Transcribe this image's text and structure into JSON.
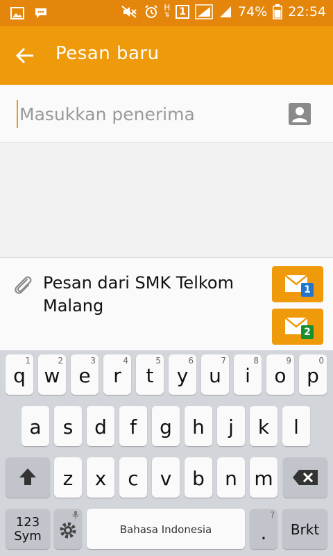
{
  "status_bar": {
    "battery": "74%",
    "time": "22:54",
    "network_badge": "1",
    "network_type": "H"
  },
  "app_bar": {
    "title": "Pesan baru"
  },
  "recipient": {
    "placeholder": "Masukkan penerima"
  },
  "compose": {
    "message": "Pesan dari SMK Telkom Malang",
    "send_buttons": [
      {
        "sim": "1",
        "badge_color": "#2277cc"
      },
      {
        "sim": "2",
        "badge_color": "#1a8f2f"
      }
    ]
  },
  "keyboard": {
    "row1": [
      {
        "key": "q",
        "hint": "1"
      },
      {
        "key": "w",
        "hint": "2"
      },
      {
        "key": "e",
        "hint": "3"
      },
      {
        "key": "r",
        "hint": "4"
      },
      {
        "key": "t",
        "hint": "5"
      },
      {
        "key": "y",
        "hint": "6"
      },
      {
        "key": "u",
        "hint": "7"
      },
      {
        "key": "i",
        "hint": "8"
      },
      {
        "key": "o",
        "hint": "9"
      },
      {
        "key": "p",
        "hint": "0"
      }
    ],
    "row2": [
      "a",
      "s",
      "d",
      "f",
      "g",
      "h",
      "j",
      "k",
      "l"
    ],
    "row3": [
      "z",
      "x",
      "c",
      "v",
      "b",
      "n",
      "m"
    ],
    "sym_top": "123",
    "sym_bottom": "Sym",
    "space_label": "Bahasa Indonesia",
    "period": ".",
    "period_hint": "?",
    "brkt": "Brkt"
  },
  "colors": {
    "status_bar": "#e3860b",
    "accent": "#ee9a0b",
    "keyboard_bg": "#d2d5da"
  }
}
